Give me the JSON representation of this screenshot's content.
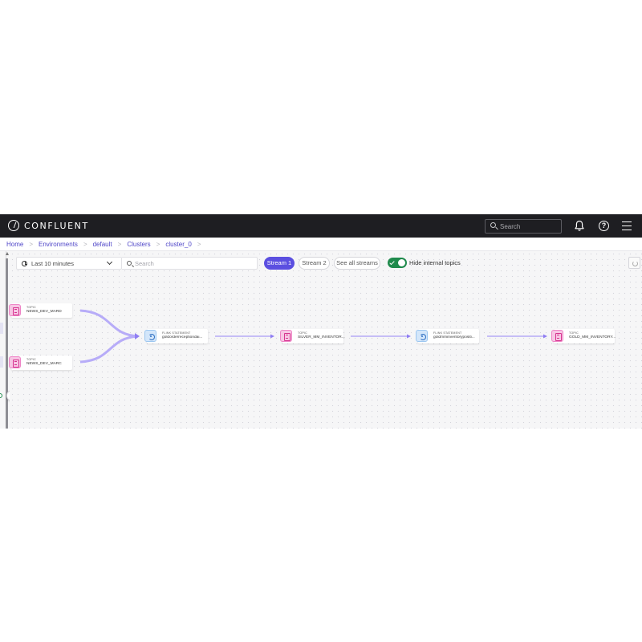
{
  "app": {
    "brand": "CONFLUENT"
  },
  "topnav": {
    "search_placeholder": "Search"
  },
  "breadcrumb": [
    "Home",
    "Environments",
    "default",
    "Clusters",
    "cluster_0"
  ],
  "breadcrumb_separator": ">",
  "toolbar": {
    "time_range": "Last 10 minutes",
    "search_placeholder": "Search",
    "streams": [
      "Stream 1",
      "Stream 2",
      "See all streams"
    ],
    "active_stream": "Stream 1",
    "hide_internal_topics": {
      "label": "Hide internal topics",
      "enabled": true
    }
  },
  "nodes": {
    "topic_mard": {
      "type": "TOPIC",
      "name": "NEWS_DEV_MARD"
    },
    "topic_marc": {
      "type": "TOPIC",
      "name": "NEWS_DEV_MARC"
    },
    "flink_1": {
      "type": "FLINK STATEMENT",
      "name": "goldorderreceptiondai..."
    },
    "topic_silver": {
      "type": "TOPIC",
      "name": "SILVER_MM_INVENTOR..."
    },
    "flink_2": {
      "type": "FLINK STATEMENT",
      "name": "goldmminventorypositi..."
    },
    "topic_gold": {
      "type": "TOPIC",
      "name": "GOLD_MM_INVENTORY..."
    }
  },
  "colors": {
    "topbar": "#1e1e22",
    "accent": "#5b4fe0",
    "link": "#4f46c8",
    "edge": "#a99bf5",
    "toggle_on": "#1f8a4c",
    "topic_icon": "#f7c6e4",
    "flink_icon": "#d3e6fa"
  }
}
